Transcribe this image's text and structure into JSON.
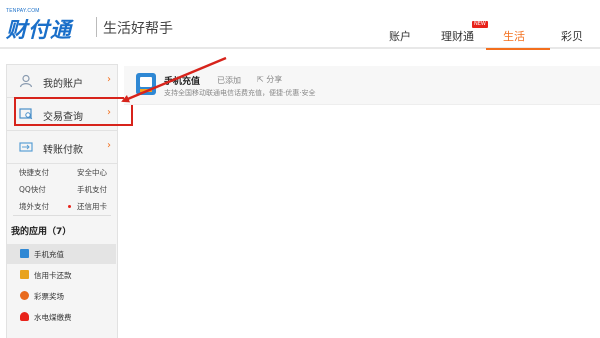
{
  "header": {
    "logo_small": "TENPAY.COM",
    "logo_main": "财付通",
    "slogan": "生活好帮手",
    "nav": [
      {
        "label": "账户"
      },
      {
        "label": "理财通",
        "badge": "NEW"
      },
      {
        "label": "生活",
        "active": true
      },
      {
        "label": "彩贝"
      }
    ]
  },
  "sidebar": {
    "menu": [
      {
        "label": "我的账户",
        "icon": "user-icon"
      },
      {
        "label": "交易查询",
        "icon": "transaction-search-icon"
      },
      {
        "label": "转账付款",
        "icon": "transfer-icon"
      }
    ],
    "quick_links": [
      [
        "快捷支付",
        "安全中心"
      ],
      [
        "QQ快付",
        "手机支付"
      ],
      [
        "境外支付",
        "还信用卡"
      ]
    ],
    "apps_title": "我的应用（7）",
    "apps": [
      {
        "label": "手机充值",
        "icon": "mobile-recharge-icon",
        "color": "#2f88d4"
      },
      {
        "label": "信用卡还款",
        "icon": "credit-card-icon",
        "color": "#e8a31d"
      },
      {
        "label": "彩票奖场",
        "icon": "lottery-icon",
        "color": "#e86a1d"
      },
      {
        "label": "水电煤缴费",
        "icon": "utility-icon",
        "color": "#e8231b"
      }
    ]
  },
  "content": {
    "title": "手机充值",
    "added": "已添加",
    "share": "分享",
    "description": "支持全国移动联通电信话费充值，便捷·优惠·安全"
  },
  "colors": {
    "brand": "#1a6fc9",
    "accent": "#f36f1d",
    "highlight": "#d7231b"
  }
}
